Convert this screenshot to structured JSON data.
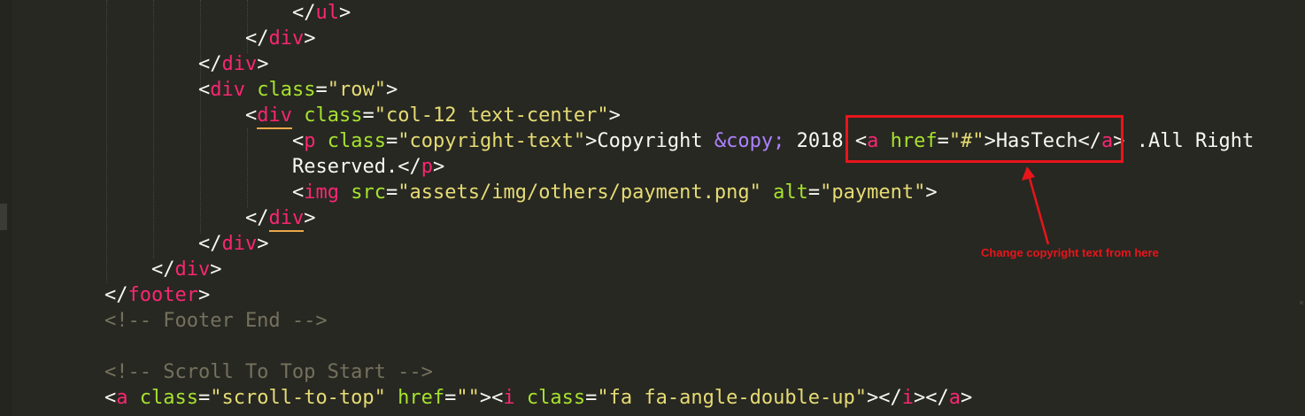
{
  "code": {
    "l1": {
      "close_open": "</",
      "tag": "ul",
      "close": ">"
    },
    "l2": {
      "close_open": "</",
      "tag": "div",
      "close": ">"
    },
    "l3": {
      "close_open": "</",
      "tag": "div",
      "close": ">"
    },
    "l4": {
      "open": "<",
      "tag": "div",
      "attr": "class",
      "eq": "=",
      "val": "\"row\"",
      "close": ">"
    },
    "l5": {
      "open": "<",
      "tag": "div",
      "attr": "class",
      "eq": "=",
      "val": "\"col-12 text-center\"",
      "close": ">"
    },
    "l6": {
      "open": "<",
      "tag": "p",
      "attr": "class",
      "eq": "=",
      "val": "\"copyright-text\"",
      "close": ">",
      "text1": "Copyright ",
      "entity": "&copy;",
      "text2": " 2018 ",
      "a_open": "<",
      "a_tag": "a",
      "a_attr": "href",
      "a_eq": "=",
      "a_val": "\"#\"",
      "a_close": ">",
      "a_text": "HasTech",
      "a_end_open": "</",
      "a_end_tag": "a",
      "a_end_close": ">",
      "text3": " .All Right"
    },
    "l7": {
      "text": "Reserved.",
      "end_open": "</",
      "end_tag": "p",
      "end_close": ">"
    },
    "l8": {
      "open": "<",
      "tag": "img",
      "attr1": "src",
      "eq1": "=",
      "val1": "\"assets/img/others/payment.png\"",
      "attr2": "alt",
      "eq2": "=",
      "val2": "\"payment\"",
      "close": ">"
    },
    "l9": {
      "close_open": "</",
      "tag": "div",
      "close": ">"
    },
    "l10": {
      "close_open": "</",
      "tag": "div",
      "close": ">"
    },
    "l11": {
      "close_open": "</",
      "tag": "div",
      "close": ">"
    },
    "l12": {
      "close_open": "</",
      "tag": "footer",
      "close": ">"
    },
    "l13": {
      "comment": "<!-- Footer End -->"
    },
    "l15": {
      "comment": "<!-- Scroll To Top Start -->"
    },
    "l16": {
      "open": "<",
      "tag": "a",
      "attr1": "class",
      "eq1": "=",
      "val1": "\"scroll-to-top\"",
      "attr2": "href",
      "eq2": "=",
      "val2": "\"\"",
      "gt": ">",
      "i_open": "<",
      "i_tag": "i",
      "i_attr": "class",
      "i_eq": "=",
      "i_val": "\"fa fa-angle-double-up\"",
      "i_gt": ">",
      "i_end_open": "</",
      "i_end_tag": "i",
      "i_end_gt": ">",
      "a_end_open": "</",
      "a_end_tag": "a",
      "a_end_gt": ">"
    }
  },
  "annotation": {
    "text": "Change copyright text from here",
    "color": "#e8151b"
  },
  "theme": {
    "background": "#272822",
    "tag": "#f92672",
    "attribute": "#a6e22e",
    "string": "#e6db74",
    "entity": "#ae81ff",
    "comment": "#75715e"
  }
}
